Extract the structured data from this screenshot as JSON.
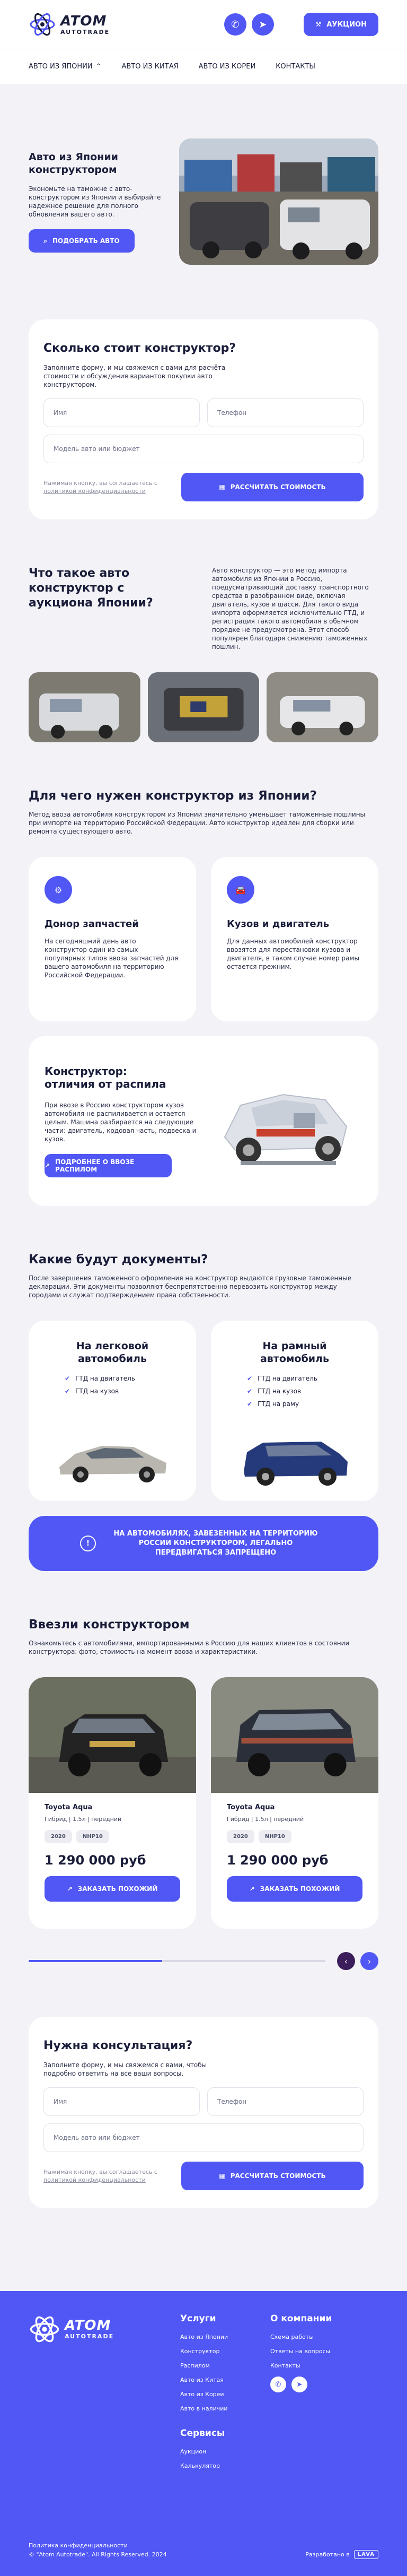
{
  "brand": {
    "name": "ATOM",
    "sub": "AUTOTRADE"
  },
  "header": {
    "auction_label": "АУКЦИОН"
  },
  "nav": [
    {
      "label": "АВТО ИЗ ЯПОНИИ"
    },
    {
      "label": "АВТО ИЗ КИТАЯ"
    },
    {
      "label": "АВТО ИЗ КОРЕИ"
    },
    {
      "label": "КОНТАКТЫ"
    }
  ],
  "hero": {
    "title": "Авто из Японии конструктором",
    "text": "Экономьте на таможне с авто-конструктором из Японии и выбирайте надежное решение для полного обновления вашего авто.",
    "button": "ПОДОБРАТЬ АВТО"
  },
  "form1": {
    "title": "Сколько стоит конструктор?",
    "lead": "Заполните форму, и мы свяжемся с вами для расчёта стоимости и обсуждения вариантов покупки авто конструктором.",
    "name_placeholder": "Имя",
    "phone_placeholder": "Телефон",
    "model_placeholder": "Модель авто или бюджет",
    "consent_text": "Нажимая кнопку, вы соглашаетесь с ",
    "consent_link": "политикой конфиденциальности",
    "submit": "РАССЧИТАТЬ СТОИМОСТЬ"
  },
  "what": {
    "title": "Что такое авто конструктор с аукциона Японии?",
    "text": "Авто конструктор — это метод импорта автомобиля из Японии в Россию, предусматривающий доставку транспортного средства в разобранном виде, включая двигатель, кузов и шасси. Для такого вида импорта оформляется исключительно ГТД, и регистрация такого автомобиля в обычном порядке не предусмотрена. Этот способ популярен благодаря снижению таможенных пошлин."
  },
  "why": {
    "title": "Для чего нужен конструктор из Японии?",
    "text": "Метод ввоза автомобиля конструктором из Японии значительно уменьшает таможенные пошлины при импорте на территорию Российской Федерации. Авто конструктор идеален для сборки или ремонта существующего авто.",
    "cards": [
      {
        "title": "Донор запчастей",
        "text": "На сегодняшний день авто конструктор один из самых популярных типов ввоза запчастей для вашего автомобиля на территорию Российской Федерации."
      },
      {
        "title": "Кузов и двигатель",
        "text": "Для данных автомобилей конструктор ввозятся для перестановки кузова и двигателя, в таком случае номер рамы остается прежним."
      }
    ]
  },
  "cut": {
    "title_line1": "Конструктор:",
    "title_line2": "отличия от распила",
    "text": "При ввозе в Россию конструктором кузов автомобиля не распиливается и остается целым. Машина разбирается на следующие части: двигатель, кодовая часть, подвеска и кузов.",
    "button": "ПОДРОБНЕЕ О ВВОЗЕ РАСПИЛОМ"
  },
  "docs": {
    "title": "Какие будут документы?",
    "text": "После завершения таможенного оформления на конструктор выдаются грузовые таможенные декларации. Эти документы позволяют беспрепятственно перевозить конструктор между городами и служат подтверждением права собственности.",
    "cards": [
      {
        "title": "На легковой автомобиль",
        "items": [
          "ГТД на двигатель",
          "ГТД на кузов"
        ]
      },
      {
        "title": "На рамный автомобиль",
        "items": [
          "ГТД на двигатель",
          "ГТД на кузов",
          "ГТД на раму"
        ]
      }
    ],
    "banner": "НА АВТОМОБИЛЯХ, ЗАВЕЗЕННЫХ НА ТЕРРИТОРИЮ РОССИИ КОНСТРУКТОРОМ, ЛЕГАЛЬНО ПЕРЕДВИГАТЬСЯ ЗАПРЕЩЕНО"
  },
  "imported": {
    "title": "Ввезли конструктором",
    "text": "Ознакомьтесь с автомобилями, импортированными в Россию для наших клиентов в состоянии конструктора: фото, стоимость на момент ввоза и характеристики.",
    "cars": [
      {
        "name": "Toyota Aqua",
        "spec": "Гибрид | 1.5л | передний",
        "year": "2020",
        "body": "NHP10",
        "price": "1 290 000 руб",
        "button": "ЗАКАЗАТЬ ПОХОЖИЙ"
      },
      {
        "name": "Toyota Aqua",
        "spec": "Гибрид | 1.5л | передний",
        "year": "2020",
        "body": "NHP10",
        "price": "1 290 000 руб",
        "button": "ЗАКАЗАТЬ ПОХОЖИЙ"
      }
    ],
    "slider_progress": 0.45
  },
  "form2": {
    "title": "Нужна консультация?",
    "lead": "Заполните форму, и мы свяжемся с вами, чтобы подробно ответить на все ваши вопросы.",
    "name_placeholder": "Имя",
    "phone_placeholder": "Телефон",
    "model_placeholder": "Модель авто или бюджет",
    "consent_text": "Нажимая кнопку, вы соглашаетесь с ",
    "consent_link": "политикой конфиденциальности",
    "submit": "РАССЧИТАТЬ СТОИМОСТЬ"
  },
  "footer": {
    "services_title": "Услуги",
    "services": [
      "Авто из Японии",
      "Конструктор",
      "Распилом",
      "Авто из Китая",
      "Авто из Кореи",
      "Авто в наличии"
    ],
    "company_title": "О компании",
    "company": [
      "Схема работы",
      "Ответы на вопросы",
      "Контакты"
    ],
    "extra_title": "Сервисы",
    "extra": [
      "Аукцион",
      "Калькулятор"
    ],
    "privacy": "Политика конфиденциальности",
    "copyright": "© \"Atom Autotrade\". All Rights Reserved. 2024",
    "dev_label": "Разработано в",
    "dev_badge": "LAVA"
  },
  "colors": {
    "accent": "#5057f5",
    "dark": "#1a1d3a",
    "bg": "#f3f3f7",
    "slider_prev": "#3a1d5a"
  }
}
